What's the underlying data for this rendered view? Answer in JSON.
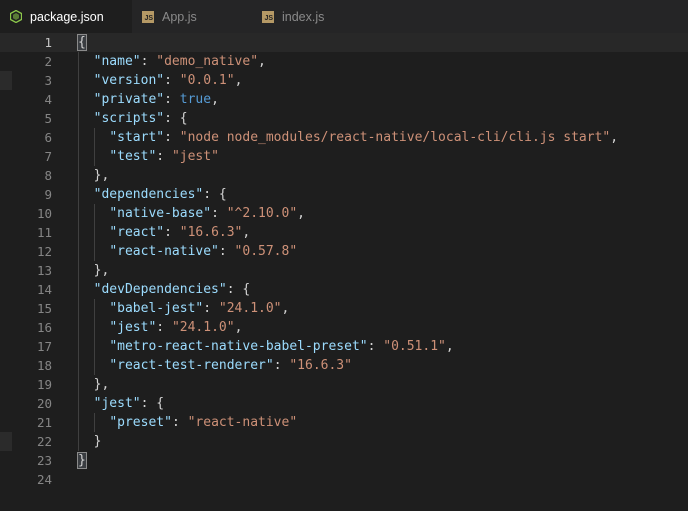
{
  "tabs": [
    {
      "label": "package.json",
      "icon": "npm-icon",
      "active": true
    },
    {
      "label": "App.js",
      "icon": "js-file-icon",
      "active": false
    },
    {
      "label": "index.js",
      "icon": "js-file-icon",
      "active": false
    }
  ],
  "colors": {
    "key": "#9cdcfe",
    "string": "#ce9178",
    "constant": "#569cd6",
    "punct": "#d4d4d4",
    "background": "#1e1e1e"
  },
  "line_numbers": [
    "1",
    "2",
    "3",
    "4",
    "5",
    "6",
    "7",
    "8",
    "9",
    "10",
    "11",
    "12",
    "13",
    "14",
    "15",
    "16",
    "17",
    "18",
    "19",
    "20",
    "21",
    "22",
    "23",
    "24"
  ],
  "code_lines": [
    "{",
    "  \"name\": \"demo_native\",",
    "  \"version\": \"0.0.1\",",
    "  \"private\": true,",
    "  \"scripts\": {",
    "    \"start\": \"node node_modules/react-native/local-cli/cli.js start\",",
    "    \"test\": \"jest\"",
    "  },",
    "  \"dependencies\": {",
    "    \"native-base\": \"^2.10.0\",",
    "    \"react\": \"16.6.3\",",
    "    \"react-native\": \"0.57.8\"",
    "  },",
    "  \"devDependencies\": {",
    "    \"babel-jest\": \"24.1.0\",",
    "    \"jest\": \"24.1.0\",",
    "    \"metro-react-native-babel-preset\": \"0.51.1\",",
    "    \"react-test-renderer\": \"16.6.3\"",
    "  },",
    "  \"jest\": {",
    "    \"preset\": \"react-native\"",
    "  }",
    "}",
    ""
  ],
  "current_line": 1
}
